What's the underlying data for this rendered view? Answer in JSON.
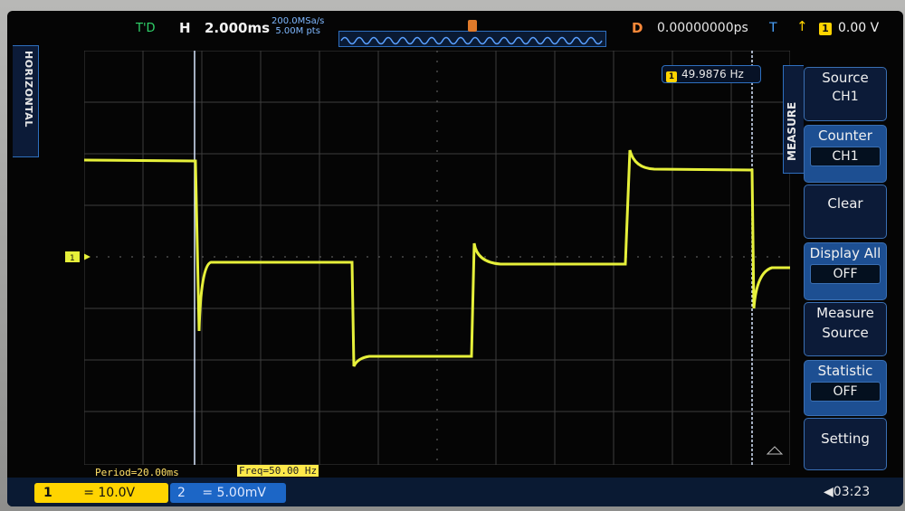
{
  "top_bar": {
    "trigger_mode": "T'D",
    "horizontal_label": "H",
    "timebase": "2.000ms",
    "sample_rate": "200.0MSa/s",
    "memory_depth": "5.00M pts",
    "delay_label": "D",
    "delay_value": "0.00000000ps",
    "trigger_label": "T",
    "trigger_source": "1",
    "trigger_level": "0.00 V"
  },
  "side_tab": {
    "label": "HORIZONTAL"
  },
  "measure": {
    "frequency_source": "1",
    "frequency": "49.9876 Hz"
  },
  "menu": {
    "title": "MEASURE",
    "items": [
      {
        "label": "Source",
        "value": "CH1"
      },
      {
        "label": "Counter",
        "value": "CH1"
      },
      {
        "label": "Clear"
      },
      {
        "label": "Display All",
        "value": "OFF"
      },
      {
        "label": "Measure",
        "label2": "Source"
      },
      {
        "label": "Statistic",
        "value": "OFF"
      },
      {
        "label": "Setting"
      }
    ]
  },
  "readouts": {
    "period": "Period=20.00ms",
    "freq": "Freq=50.00 Hz"
  },
  "channels": [
    {
      "id": "1",
      "scale": "= 10.0V",
      "color": "#ffd400"
    },
    {
      "id": "2",
      "scale": "= 5.00mV",
      "color": "#1c66c6"
    }
  ],
  "clock": "03:23",
  "colors": {
    "trace": "#e6f03a",
    "grid": "#3d3d3d",
    "accent": "#2e6fbf"
  }
}
